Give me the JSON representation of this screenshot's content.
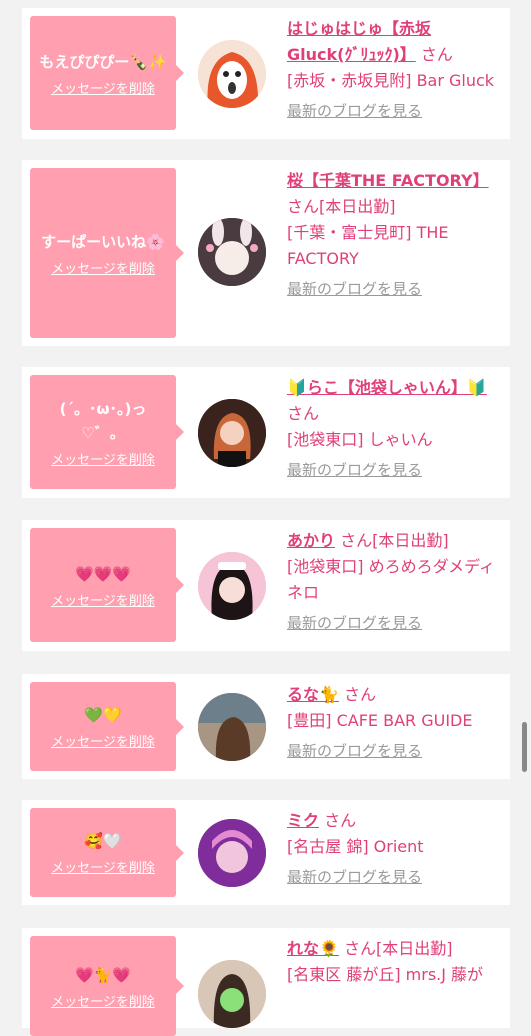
{
  "delete_label": "メッセージを削除",
  "blog_label": "最新のブログを見る",
  "san": "さん",
  "cards": [
    {
      "message": "もえぴぴぴー🍾✨",
      "name": "はじゅはじゅ【赤坂Gluck(ｸﾞﾘｭｯｸ)】",
      "status": "",
      "shop": "[赤坂・赤坂見附] Bar Gluck"
    },
    {
      "message": "すーぱーいいね🌸",
      "name": "桜【千葉THE FACTORY】",
      "status": "[本日出勤]",
      "shop": "[千葉・富士見町] THE FACTORY"
    },
    {
      "message": "(´。･ω･。)っ♡゛。",
      "name": "🔰らこ【池袋しゃいん】🔰",
      "status": "",
      "shop": "[池袋東口] しゃいん"
    },
    {
      "message": "💗💗💗",
      "name": "あかり",
      "status": "[本日出勤]",
      "shop": "[池袋東口] めろめろダメディネロ"
    },
    {
      "message": "💚💛",
      "name": "るな🐈",
      "status": "",
      "shop": "[豊田] CAFE BAR GUIDE"
    },
    {
      "message": "🥰🤍",
      "name": "ミク",
      "status": "",
      "shop": "[名古屋 錦] Orient"
    },
    {
      "message": "💗🐈💗",
      "name": "れな🌻",
      "status": "[本日出勤]",
      "shop": "[名東区 藤が丘] mrs.J 藤が"
    }
  ]
}
